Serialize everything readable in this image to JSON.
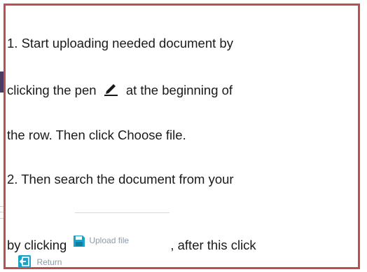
{
  "instructions": {
    "line1": "1. Start uploading needed document by",
    "line2_before": "clicking the pen",
    "line2_after": "at the beginning of",
    "line3": "the row. Then click Choose file.",
    "line4": "2. Then search the document from your",
    "line5_before": "by clicking",
    "line5_after": ", after this click"
  },
  "buttons": {
    "upload_label": "Upload file",
    "return_label": "Return"
  },
  "icons": {
    "pen": "pen-icon",
    "upload": "floppy-disk-icon",
    "return": "return-arrow-icon"
  },
  "colors": {
    "callout_border": "#bb5050",
    "button_icon": "#1aa3c8",
    "button_text": "#8e9aa6"
  }
}
